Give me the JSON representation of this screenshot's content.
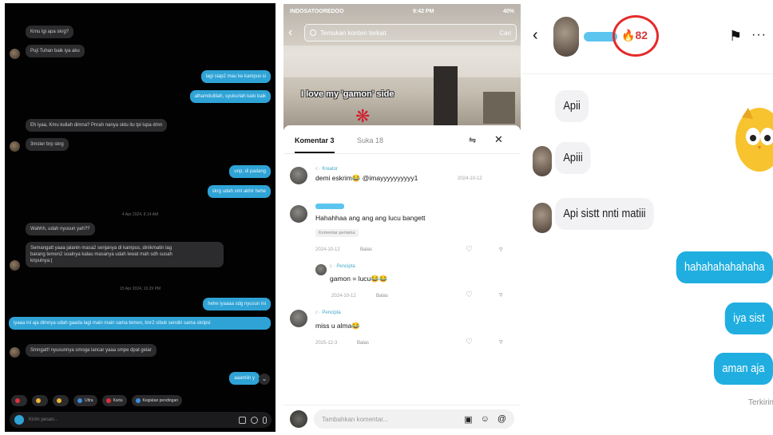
{
  "panel1": {
    "messages": [
      {
        "side": "in",
        "text": "Kmu lgi apa skrg?",
        "avatar": false
      },
      {
        "side": "in",
        "text": "Puji Tuhan baik iya aku",
        "avatar": true
      },
      {
        "side": "out",
        "text": "lagi siap2 mau ke kampus si"
      },
      {
        "side": "out",
        "text": "alhamdulillah, syukurlah kalo baik"
      },
      {
        "side": "in",
        "text": "Eh iyaa, Kmu kuliah dimna? Pnrah nanya sktu itu tpi lupa dmn",
        "avatar": false
      },
      {
        "side": "in",
        "text": "3mster brp skrg",
        "avatar": true
      },
      {
        "side": "out",
        "text": "unp, di padang"
      },
      {
        "side": "out",
        "text": "skrg udah smt akhir hehe"
      },
      {
        "side": "in",
        "text": "Wahhh, udah nyusun yah??",
        "avatar": false
      },
      {
        "side": "in",
        "text": "Semangatt yaaa jalanin masa2 senjanya di kampus, dinikmatin lag\nbarang temen2 soalnya kalau masanya udah lewat mah sdh susah\nknpulnya:(",
        "avatar": true
      },
      {
        "side": "out",
        "text": "hehe iyaaaa sdg nyusun ini"
      },
      {
        "side": "out",
        "text": "iyaaa ini aja dimnya udah gaada lagi main main sama temen, bnr2 sibuk sendiri sama skripsi"
      },
      {
        "side": "in",
        "text": "Smngatt! nyusunnya smoga lancar yaaa smpe dpat gelar",
        "avatar": true
      },
      {
        "side": "out",
        "text": "aaamiin y"
      }
    ],
    "timestamps": [
      "4 Apr 2024, 8.14 AM",
      "15 Apr 2024, 10.29 PM"
    ],
    "reactions": [
      {
        "label": "",
        "color": "#e0303a"
      },
      {
        "label": "",
        "color": "#f2b533"
      },
      {
        "label": "",
        "color": "#f2b533"
      },
      {
        "label": "Ultra",
        "color": "#3a8fe0"
      },
      {
        "label": "Kartu",
        "color": "#e0303a"
      },
      {
        "label": "Kegiatan pendingan",
        "color": "#3a8fe0"
      }
    ],
    "composer_placeholder": "Kirim pesan..."
  },
  "panel2": {
    "status": {
      "carrier": "INDOSATOOREDOO",
      "time": "9:42 PM",
      "battery": "40%"
    },
    "search_placeholder": "Temukan konten terkait",
    "search_button": "Cari",
    "caption": "I love my 'gamon' side",
    "tabs": [
      "Komentar 3",
      "Suka 18"
    ],
    "comments": [
      {
        "author": "c",
        "role": "Kreator",
        "text": "demi eskrim😂 @imayyyyyyyyyy1",
        "date": "2024-10-12",
        "reply": "",
        "chip": ""
      },
      {
        "author": "",
        "role": "",
        "text": "Hahahhaa ang ang ang lucu bangett",
        "date": "2024-10-12",
        "reply": "Balas",
        "chip": "Komentar pertama"
      },
      {
        "author": "c",
        "role": "Pencipta",
        "text": "gamon = lucu😂😂",
        "date": "2024-10-12",
        "reply": "Balas",
        "chip": ""
      },
      {
        "author": "c",
        "role": "Pencipta",
        "text": "miss u alma😂",
        "date": "2025-12-3",
        "reply": "Balas",
        "chip": ""
      }
    ],
    "add_placeholder": "Tambahkan komentar..."
  },
  "panel3": {
    "streak": "82",
    "messages": [
      {
        "side": "in",
        "text": "Apii"
      },
      {
        "side": "in",
        "text": "Apiii"
      },
      {
        "side": "in",
        "text": "Api sistt nnti matiii"
      },
      {
        "side": "out",
        "text": "hahahahahahaha"
      },
      {
        "side": "out",
        "text": "iya sist"
      },
      {
        "side": "out",
        "text": "aman aja"
      }
    ],
    "seen_label": "Terkirim"
  }
}
